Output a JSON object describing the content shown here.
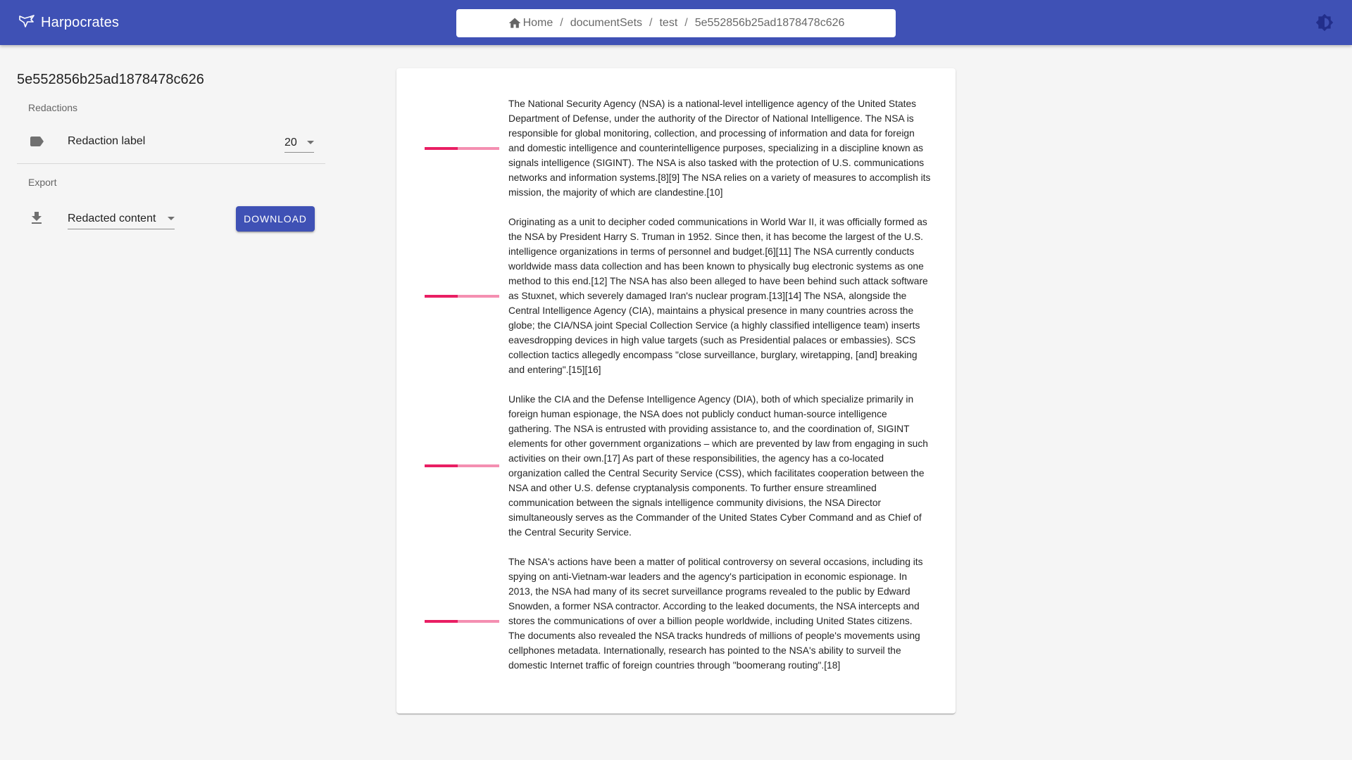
{
  "app": {
    "title": "Harpocrates",
    "logo_icon": "bird-logo-icon",
    "theme_icon": "brightness-icon"
  },
  "breadcrumbs": [
    "Home",
    "documentSets",
    "test",
    "5e552856b25ad1878478c626"
  ],
  "document": {
    "id": "5e552856b25ad1878478c626"
  },
  "sidebar": {
    "redactions_header": "Redactions",
    "redaction_label": "Redaction label",
    "redaction_icon": "label-icon",
    "redaction_value": "20",
    "export_header": "Export",
    "export_icon": "download-icon",
    "export_option": "Redacted content",
    "download_label": "DOWNLOAD"
  },
  "paragraphs": [
    {
      "text": "The National Security Agency (NSA) is a national-level intelligence agency of the United States Department of Defense, under the authority of the Director of National Intelligence. The NSA is responsible for global monitoring, collection, and processing of information and data for foreign and domestic intelligence and counterintelligence purposes, specializing in a discipline known as signals intelligence (SIGINT). The NSA is also tasked with the protection of U.S. communications networks and information systems.[8][9] The NSA relies on a variety of measures to accomplish its mission, the majority of which are clandestine.[10]",
      "score": 0.44
    },
    {
      "text": "Originating as a unit to decipher coded communications in World War II, it was officially formed as the NSA by President Harry S. Truman in 1952. Since then, it has become the largest of the U.S. intelligence organizations in terms of personnel and budget.[6][11] The NSA currently conducts worldwide mass data collection and has been known to physically bug electronic systems as one method to this end.[12] The NSA has also been alleged to have been behind such attack software as Stuxnet, which severely damaged Iran's nuclear program.[13][14] The NSA, alongside the Central Intelligence Agency (CIA), maintains a physical presence in many countries across the globe; the CIA/NSA joint Special Collection Service (a highly classified intelligence team) inserts eavesdropping devices in high value targets (such as Presidential palaces or embassies). SCS collection tactics allegedly encompass \"close surveillance, burglary, wiretapping, [and] breaking and entering\".[15][16]",
      "score": 0.44
    },
    {
      "text": "Unlike the CIA and the Defense Intelligence Agency (DIA), both of which specialize primarily in foreign human espionage, the NSA does not publicly conduct human-source intelligence gathering. The NSA is entrusted with providing assistance to, and the coordination of, SIGINT elements for other government organizations – which are prevented by law from engaging in such activities on their own.[17] As part of these responsibilities, the agency has a co-located organization called the Central Security Service (CSS), which facilitates cooperation between the NSA and other U.S. defense cryptanalysis components. To further ensure streamlined communication between the signals intelligence community divisions, the NSA Director simultaneously serves as the Commander of the United States Cyber Command and as Chief of the Central Security Service.",
      "score": 0.44
    },
    {
      "text": "The NSA's actions have been a matter of political controversy on several occasions, including its spying on anti-Vietnam-war leaders and the agency's participation in economic espionage. In 2013, the NSA had many of its secret surveillance programs revealed to the public by Edward Snowden, a former NSA contractor. According to the leaked documents, the NSA intercepts and stores the communications of over a billion people worldwide, including United States citizens. The documents also revealed the NSA tracks hundreds of millions of people's movements using cellphones metadata. Internationally, research has pointed to the NSA's ability to surveil the domestic Internet traffic of foreign countries through \"boomerang routing\".[18]",
      "score": 0.44
    }
  ],
  "colors": {
    "primary": "#3f51b5",
    "score_fill": "#e91e63",
    "score_track": "#f48fb1",
    "background": "#f5f5f5"
  }
}
